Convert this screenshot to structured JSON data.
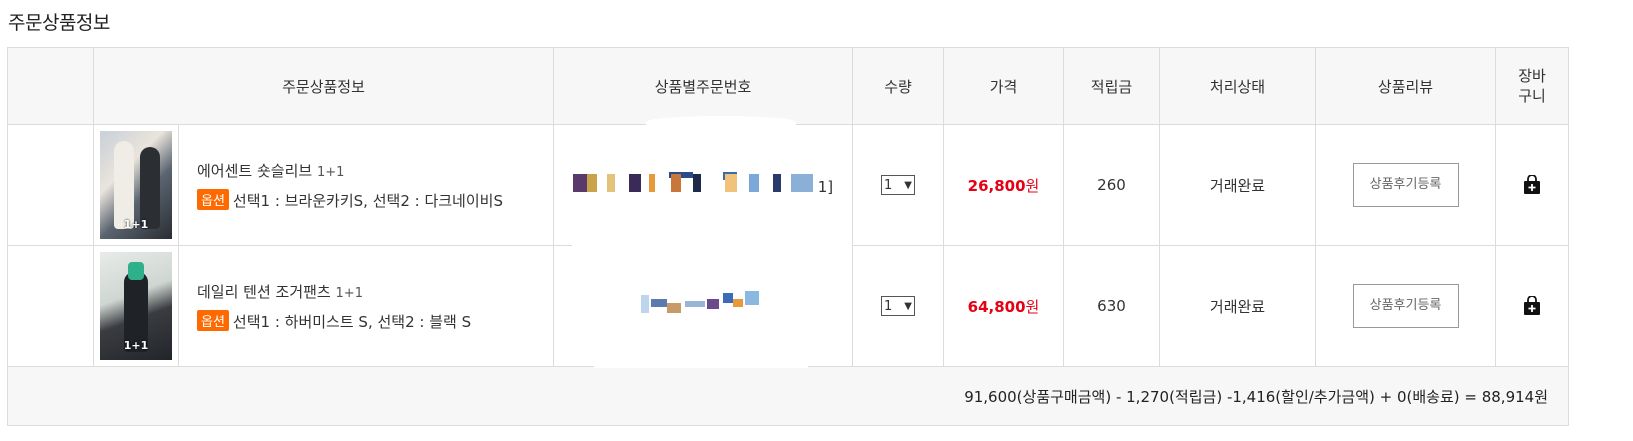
{
  "section_title": "주문상품정보",
  "columns": [
    "주문상품정보",
    "상품별주문번호",
    "수량",
    "가격",
    "적립금",
    "처리상태",
    "상품리뷰",
    "장바구니"
  ],
  "cart_col_lines": [
    "장바",
    "구니"
  ],
  "items": [
    {
      "thumb_badge": "1+1",
      "name": "에어센트 숏슬리브",
      "name_suffix": "1+1",
      "option_tag": "옵션",
      "option_text": "선택1 : 브라운카키S, 선택2 : 다크네이비S",
      "order_no_tail": "1]",
      "qty": "1",
      "price": "26,800",
      "price_unit": "원",
      "points": "260",
      "status": "거래완료",
      "review_label": "상품후기등록"
    },
    {
      "thumb_badge": "1+1",
      "name": "데일리 텐션 조거팬츠",
      "name_suffix": "1+1",
      "option_tag": "옵션",
      "option_text": "선택1 : 하버미스트 S, 선택2 : 블랙 S",
      "order_no_tail": "",
      "qty": "1",
      "price": "64,800",
      "price_unit": "원",
      "points": "630",
      "status": "거래완료",
      "review_label": "상품후기등록"
    }
  ],
  "summary": "91,600(상품구매금액) - 1,270(적립금) -1,416(할인/추가금액) + 0(배송료) = 88,914원",
  "icons": {
    "cart": "shopping-bag-plus-icon",
    "qty_dropdown": "chevron-down-icon"
  },
  "colors": {
    "price": "#e60012",
    "option_tag": "#ff6a00",
    "header_bg": "#f7f7f7"
  }
}
